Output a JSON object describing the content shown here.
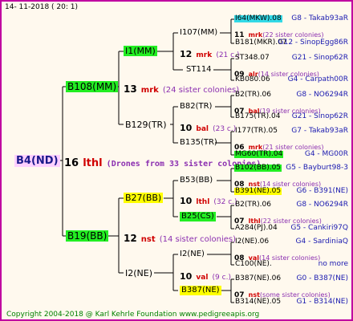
{
  "date": "14- 11-2018 (  20:  1)",
  "root": {
    "name": "B4(ND)",
    "num": "16",
    "mark": "lthl",
    "note": "(Drones from 33 sister colonies)"
  },
  "gen1": [
    {
      "name": "B108(MM)",
      "num": "13",
      "mark": "mrk",
      "note": "(24 sister colonies)"
    },
    {
      "name": "B19(BB)",
      "num": "12",
      "mark": "nst",
      "note": "(14 sister colonies)"
    }
  ],
  "gen2": [
    {
      "name": "I1(MM)",
      "num": "12",
      "mark": "mrk",
      "note": "(21 c.)"
    },
    {
      "name": "B129(TR)",
      "num": "10",
      "mark": "bal",
      "note": "(23 c.)"
    },
    {
      "name": "B27(BB)",
      "num": "10",
      "mark": "lthl",
      "note": "(32 c.)"
    },
    {
      "name": "I2(NE)",
      "num": "10",
      "mark": "val",
      "note": "(9 c.)"
    }
  ],
  "gen3": [
    "I107(MM)",
    "ST114",
    "B82(TR)",
    "B135(TR)",
    "B53(BB)",
    "B25(CS)",
    "I2(NE)",
    "B387(NE)"
  ],
  "gen4": [
    {
      "name": "I64(MKW).08",
      "right": "G8 - Takab93aR"
    },
    {
      "num": "11",
      "mark": "mrk",
      "note": "(22 sister colonies)"
    },
    {
      "name": "B181(MKR).07",
      "right": "G12 - SinopEgg86R"
    },
    {
      "name": "ST348.07",
      "right": "G21 - Sinop62R"
    },
    {
      "num": "09",
      "mark": "alr",
      "note": "(14 sister colonies)"
    },
    {
      "name": "KB080.06",
      "right": "G4 - Carpath00R"
    },
    {
      "name": "B2(TR).06",
      "right": "G8 - NO6294R"
    },
    {
      "num": "07",
      "mark": "bal",
      "note": "(19 sister colonies)"
    },
    {
      "name": "B175(TR).04",
      "right": "G21 - Sinop62R"
    },
    {
      "name": "I177(TR).05",
      "right": "G7 - Takab93aR"
    },
    {
      "num": "06",
      "mark": "mrk",
      "note": "(21 sister colonies)"
    },
    {
      "name": "MG60(TR).04",
      "right": "G4 - MG00R"
    },
    {
      "name": "B102(BB).05",
      "right": "G5 - Bayburt98-3"
    },
    {
      "num": "08",
      "mark": "nst",
      "note": "(14 sister colonies)"
    },
    {
      "name": "B391(NE).05",
      "right": "G6 - B391(NE)"
    },
    {
      "name": "B2(TR).06",
      "right": "G8 - NO6294R"
    },
    {
      "num": "07",
      "mark": "lthl",
      "note": "(22 sister colonies)"
    },
    {
      "name": "A284(PJ).04",
      "right": "G5 - Cankiri97Q"
    },
    {
      "name": "I2(NE).06",
      "right": "G4 - SardiniaQ"
    },
    {
      "num": "08",
      "mark": "val",
      "note": "(14 sister colonies)"
    },
    {
      "name": "C100(NE).",
      "right": "no more"
    },
    {
      "name": "B387(NE).06",
      "right": "G0 - B387(NE)"
    },
    {
      "num": "07",
      "mark": "nst",
      "note": "(some sister colonies)"
    },
    {
      "name": "B314(NE).05",
      "right": "G1 - B314(NE)"
    }
  ],
  "footer": "Copyright 2004-2018 @ Karl Kehrle Foundation    www.pedigreeapis.org"
}
